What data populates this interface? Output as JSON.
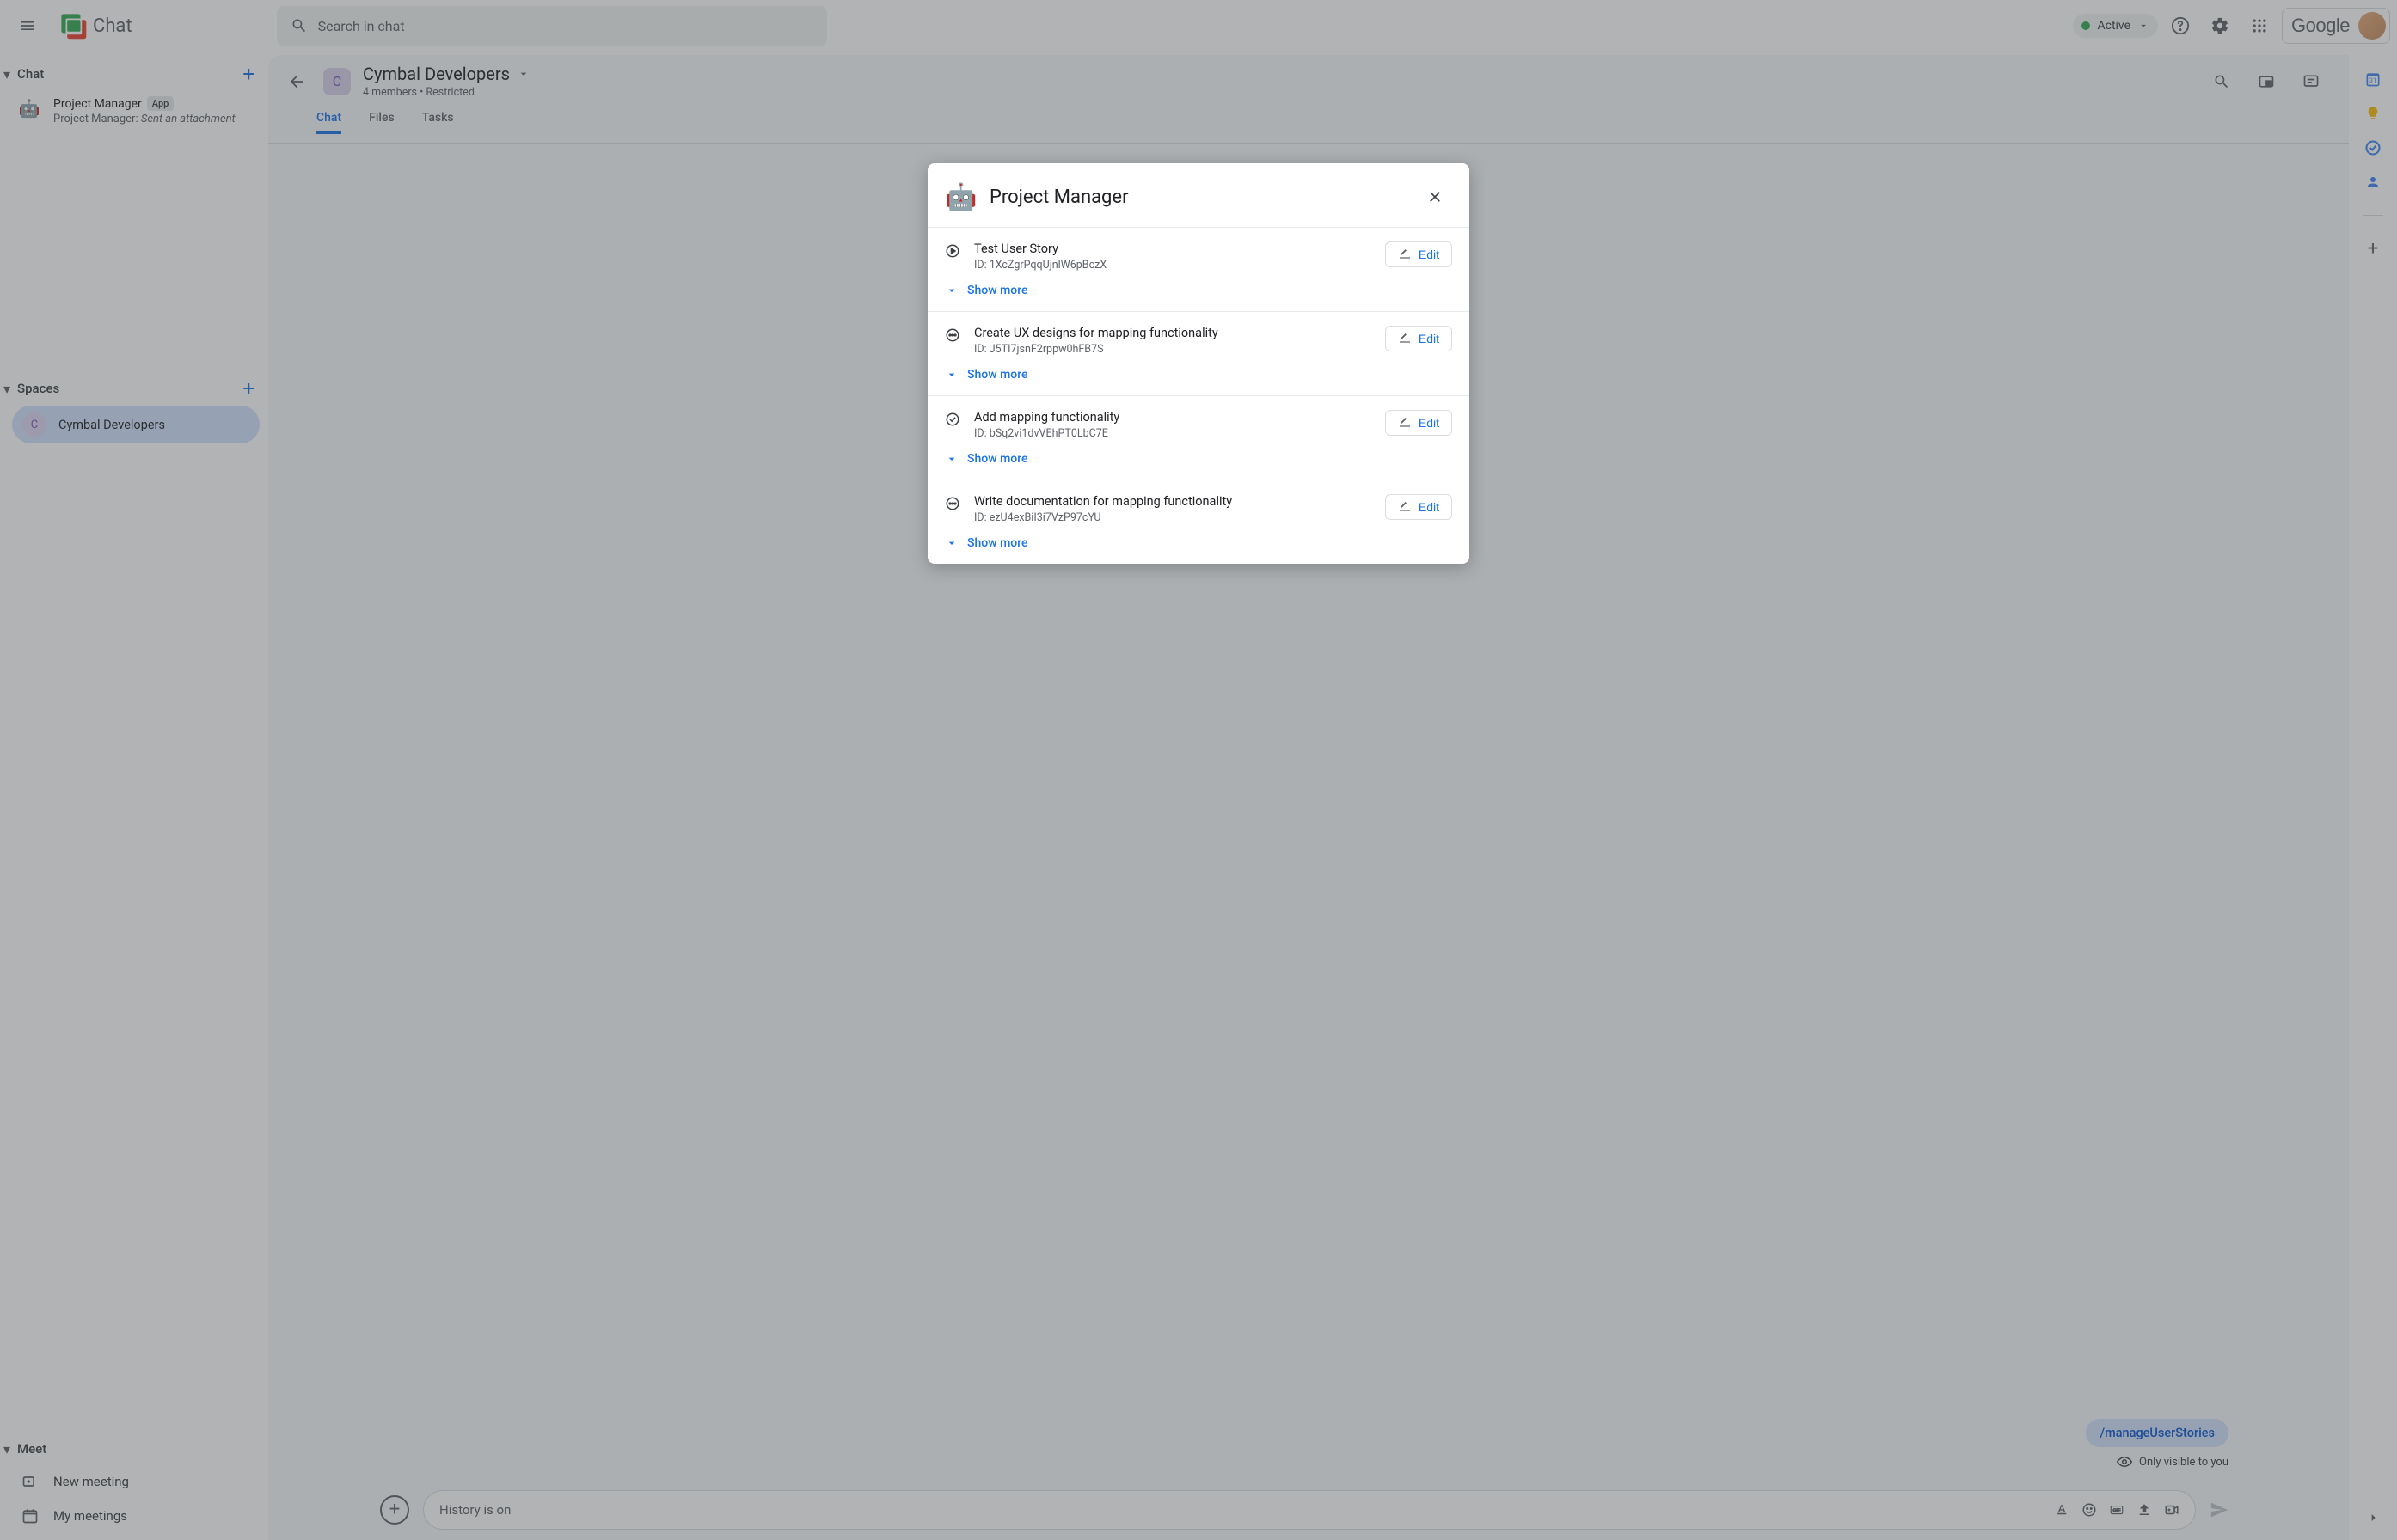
{
  "app": {
    "name": "Chat"
  },
  "search": {
    "placeholder": "Search in chat"
  },
  "status": {
    "label": "Active"
  },
  "google_label": "Google",
  "sidebar": {
    "chat_label": "Chat",
    "conv": {
      "title": "Project Manager",
      "badge": "App",
      "sub_prefix": "Project Manager: ",
      "sub_action": "Sent an attachment"
    },
    "spaces_label": "Spaces",
    "space_name": "Cymbal Developers",
    "space_initial": "C",
    "meet_label": "Meet",
    "new_meeting": "New meeting",
    "my_meetings": "My meetings"
  },
  "space": {
    "title": "Cymbal Developers",
    "initial": "C",
    "subtitle": "4 members  •  Restricted",
    "tabs": {
      "chat": "Chat",
      "files": "Files",
      "tasks": "Tasks"
    }
  },
  "message": {
    "cmd": "/manageUserStories",
    "visibility": "Only visible to you"
  },
  "compose": {
    "placeholder": "History is on"
  },
  "modal": {
    "title": "Project Manager",
    "edit_label": "Edit",
    "show_more": "Show more",
    "stories": [
      {
        "icon": "play",
        "title": "Test User Story",
        "id": "ID: 1XcZgrPqqUjnlW6pBczX"
      },
      {
        "icon": "ellipsis",
        "title": "Create UX designs for mapping functionality",
        "id": "ID: J5TI7jsnF2rppw0hFB7S"
      },
      {
        "icon": "check",
        "title": "Add mapping functionality",
        "id": "ID: bSq2vi1dvVEhPT0LbC7E"
      },
      {
        "icon": "ellipsis",
        "title": "Write documentation for mapping functionality",
        "id": "ID: ezU4exBiI3i7VzP97cYU"
      }
    ]
  }
}
